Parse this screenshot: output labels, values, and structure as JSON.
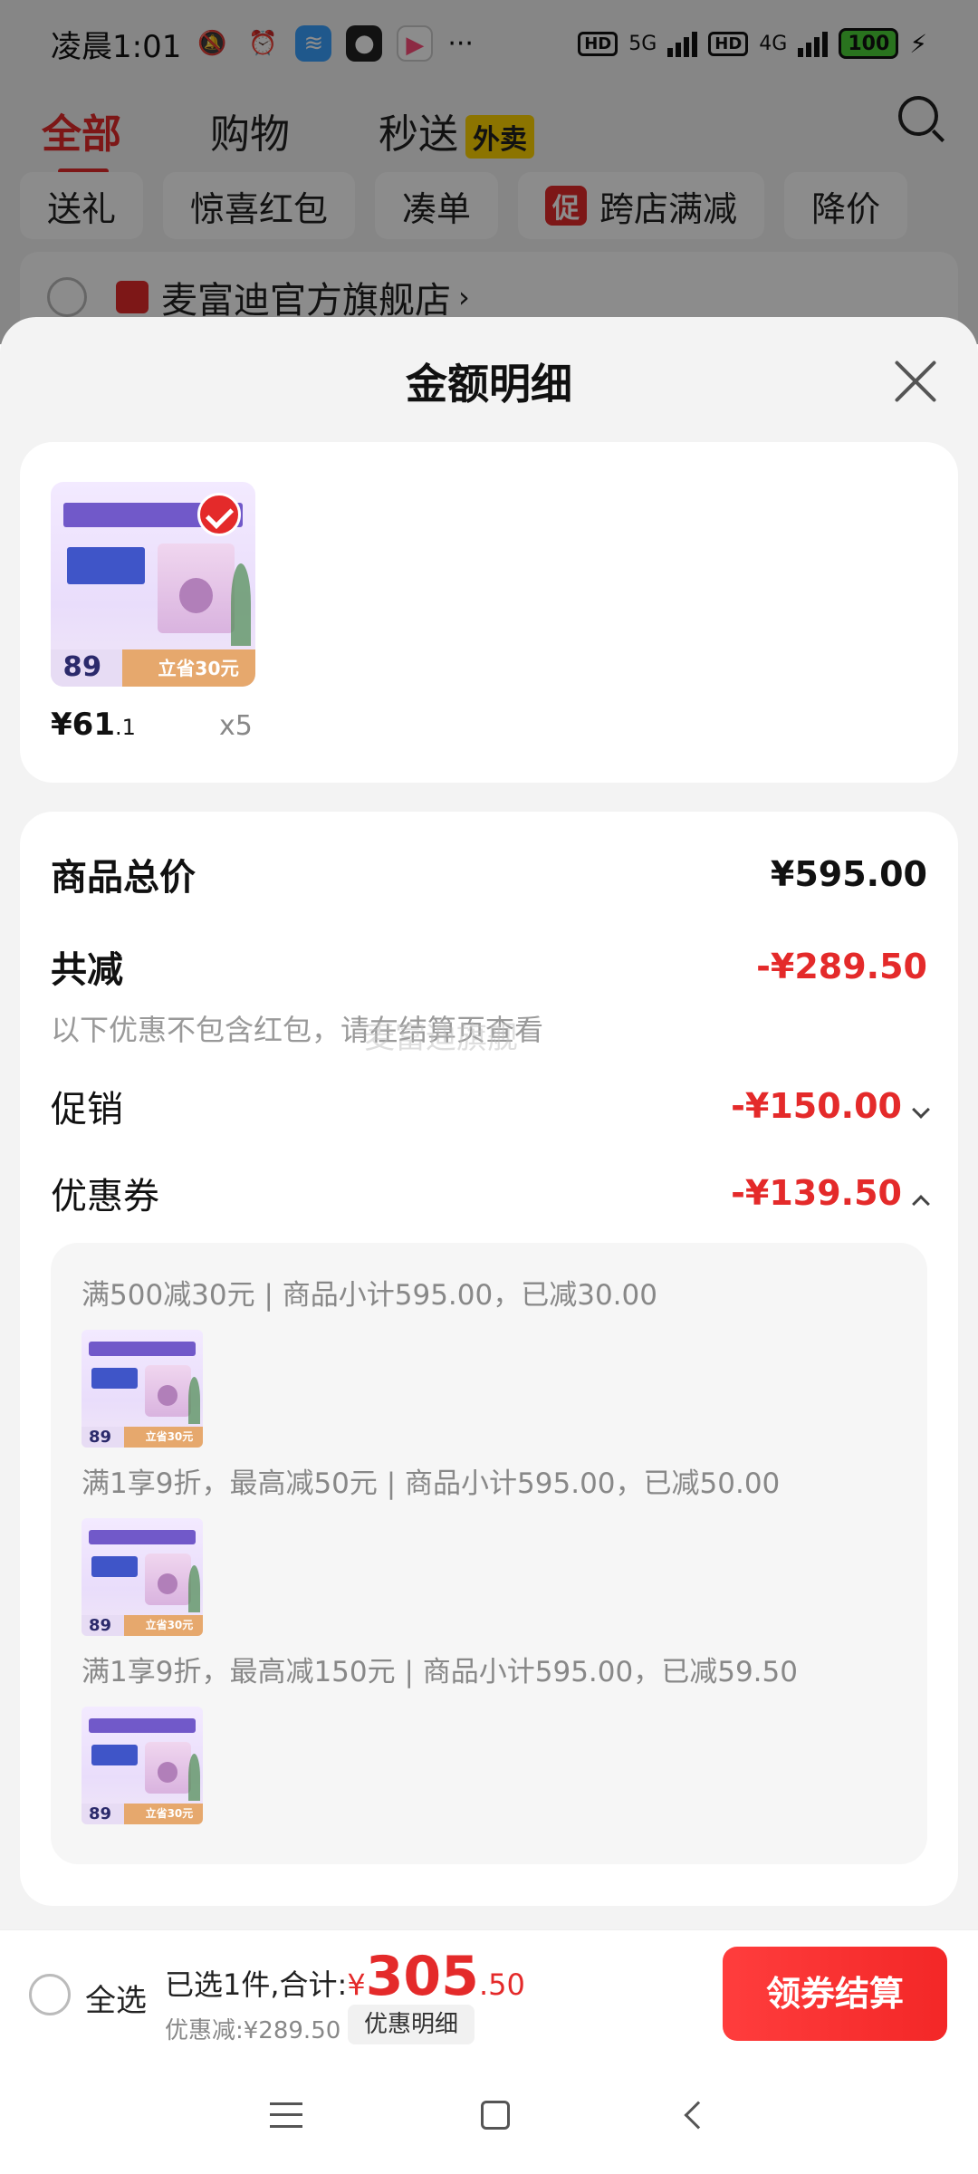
{
  "status_bar": {
    "time": "凌晨1:01",
    "network1": "5G",
    "network2": "4G",
    "hd": "HD",
    "battery": "100"
  },
  "top_tabs": [
    {
      "label": "全部"
    },
    {
      "label": "购物"
    },
    {
      "label": "秒送",
      "badge": "外卖"
    }
  ],
  "chips": [
    "送礼",
    "惊喜红包",
    "凑单",
    "跨店满减",
    "降价"
  ],
  "chip_promo_badge": "促",
  "store": {
    "name": "麦富迪官方旗舰店",
    "arrow": "›"
  },
  "sheet": {
    "title": "金额明细",
    "product": {
      "price_main": "¥61",
      "price_dec": ".1",
      "qty": "x5",
      "thumb_price": "89",
      "thumb_save": "立省30元"
    },
    "total_label": "商品总价",
    "total_value": "¥595.00",
    "discount_label": "共减",
    "discount_value": "-¥289.50",
    "note": "以下优惠不包含红包，请在结算页查看",
    "watermark": "麦富迪旗舰",
    "promo_label": "促销",
    "promo_value": "-¥150.00",
    "coupon_label": "优惠券",
    "coupon_value": "-¥139.50",
    "coupons": [
      {
        "text": "满500减30元 | 商品小计595.00，已减30.00"
      },
      {
        "text": "满1享9折，最高减50元 | 商品小计595.00，已减50.00"
      },
      {
        "text": "满1享9折，最高减150元 | 商品小计595.00，已减59.50"
      }
    ]
  },
  "bottom_bar": {
    "select_all": "全选",
    "selected_text": "已选1件,合计:",
    "currency": "¥",
    "total_int": "305",
    "total_dec": ".50",
    "discount_text": "优惠减:¥289.50",
    "detail_button": "优惠明细",
    "checkout_button": "领券结算"
  },
  "colors": {
    "accent": "#e42a2a",
    "badge_yellow": "#ffd400"
  }
}
